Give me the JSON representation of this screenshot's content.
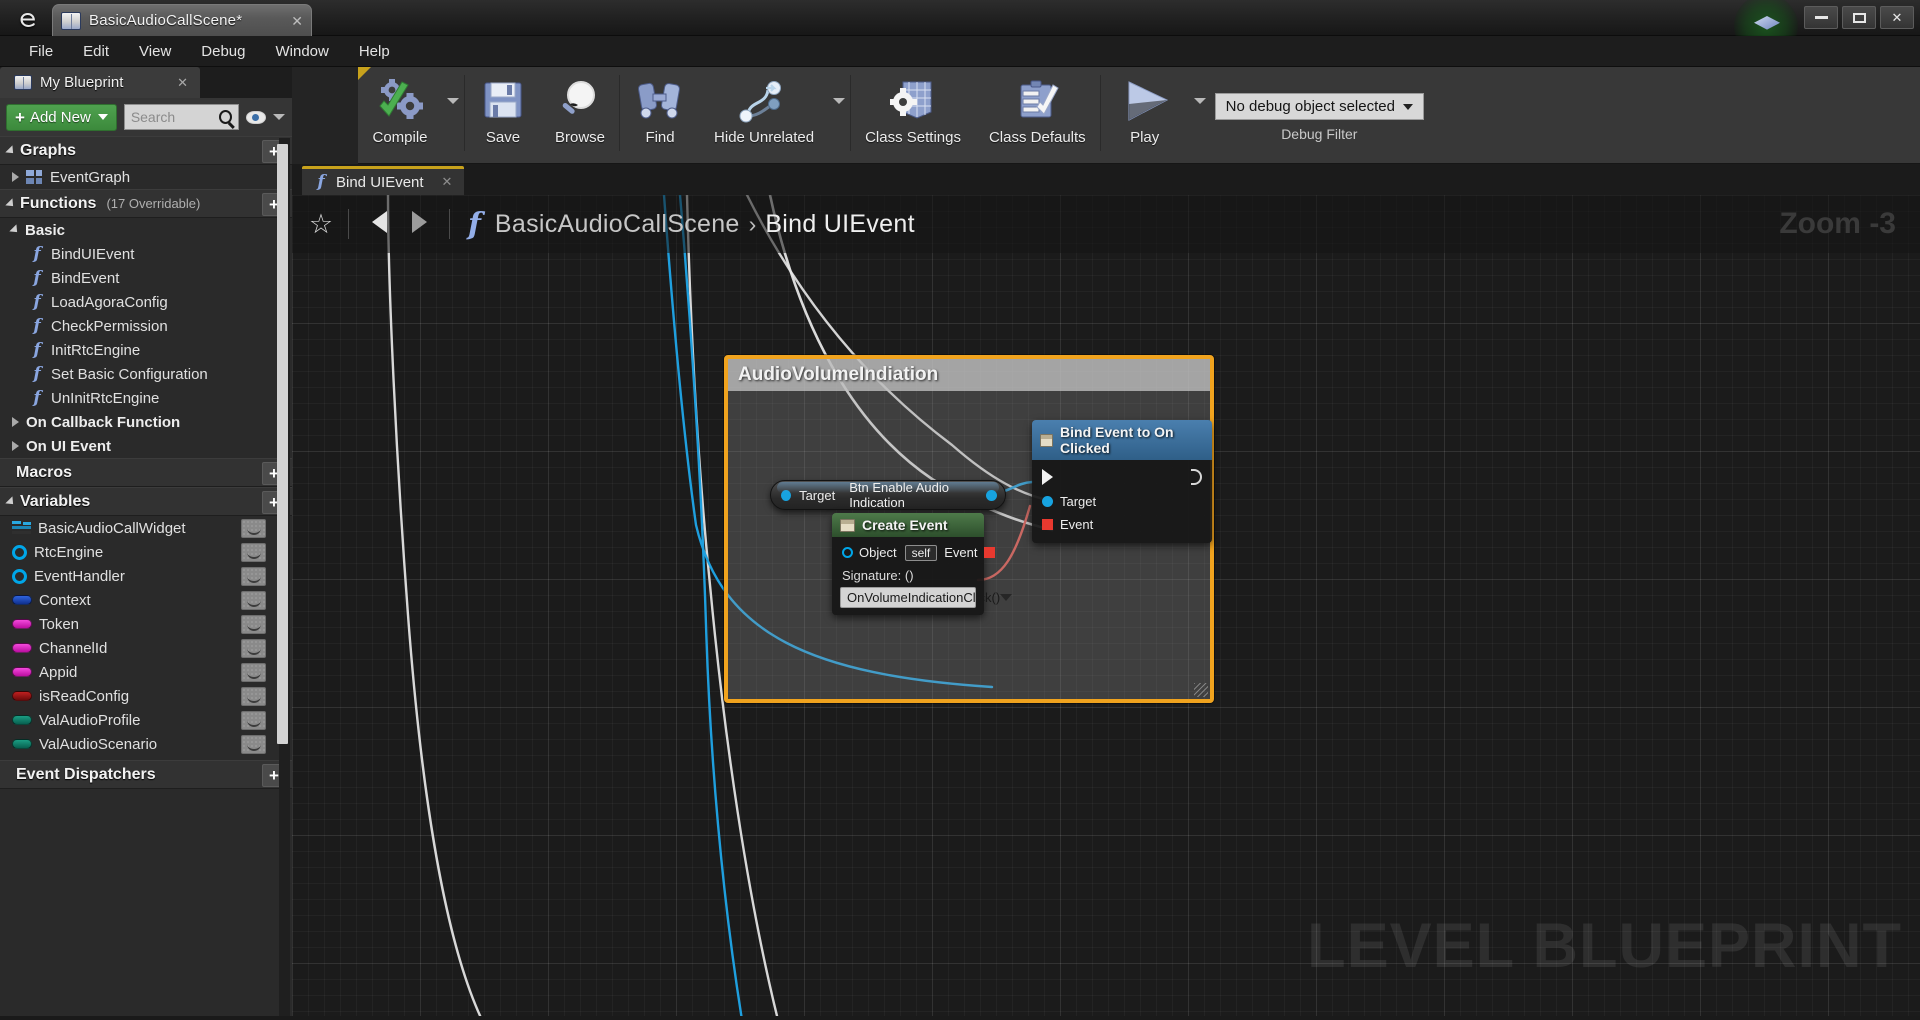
{
  "titlebar": {
    "logo": "unreal-logo",
    "tab_title": "BasicAudioCallScene*",
    "tab_icon": "blueprint-book-icon",
    "close_label": "✕",
    "orb_icon": "tutorial-hat-icon",
    "minimize_label": "minimize",
    "maximize_label": "maximize",
    "close_window_label": "✕"
  },
  "menubar": {
    "items": [
      "File",
      "Edit",
      "View",
      "Debug",
      "Window",
      "Help"
    ]
  },
  "toolbar": {
    "buttons": [
      {
        "label": "Compile",
        "icon": "compile-gears-check-icon",
        "has_dropdown": true
      },
      {
        "label": "Save",
        "icon": "save-floppy-icon",
        "has_dropdown": false
      },
      {
        "label": "Browse",
        "icon": "browse-magnifier-icon",
        "has_dropdown": false
      },
      {
        "label": "Find",
        "icon": "find-binoculars-icon",
        "has_dropdown": false
      },
      {
        "label": "Hide Unrelated",
        "icon": "hide-unrelated-nodes-icon",
        "has_dropdown": true
      },
      {
        "label": "Class Settings",
        "icon": "class-settings-gear-icon",
        "has_dropdown": false
      },
      {
        "label": "Class Defaults",
        "icon": "class-defaults-clipboard-icon",
        "has_dropdown": false
      },
      {
        "label": "Play",
        "icon": "play-triangle-icon",
        "has_dropdown": true
      }
    ],
    "debug_filter": {
      "value": "No debug object selected",
      "caption": "Debug Filter"
    }
  },
  "sidebar": {
    "tab": {
      "label": "My Blueprint",
      "icon": "blueprint-book-icon",
      "close": "✕"
    },
    "add_new_label": "Add New",
    "search": {
      "placeholder": "Search",
      "value": ""
    },
    "eye_icon": "visibility-eye-icon",
    "sections": [
      {
        "title": "Graphs",
        "expanded": true,
        "add_label": "+",
        "items": [
          {
            "label": "EventGraph",
            "icon": "event-graph-icon",
            "indent": 1,
            "expandable": true
          }
        ]
      },
      {
        "title": "Functions",
        "subtitle": "(17 Overridable)",
        "expanded": true,
        "add_label": "+",
        "groups": [
          {
            "label": "Basic",
            "expanded": true,
            "items": [
              {
                "label": "BindUIEvent",
                "icon": "function-icon"
              },
              {
                "label": "BindEvent",
                "icon": "function-icon"
              },
              {
                "label": "LoadAgoraConfig",
                "icon": "function-icon"
              },
              {
                "label": "CheckPermission",
                "icon": "function-icon"
              },
              {
                "label": "InitRtcEngine",
                "icon": "function-icon"
              },
              {
                "label": "Set Basic Configuration",
                "icon": "function-icon"
              },
              {
                "label": "UnInitRtcEngine",
                "icon": "function-icon"
              }
            ]
          },
          {
            "label": "On Callback Function",
            "expanded": false,
            "items": []
          },
          {
            "label": "On UI Event",
            "expanded": false,
            "items": []
          }
        ]
      },
      {
        "title": "Macros",
        "expanded": false,
        "add_label": "+",
        "items": []
      },
      {
        "title": "Variables",
        "expanded": true,
        "add_label": "+",
        "items": [
          {
            "label": "BasicAudioCallWidget",
            "icon": "widget-variable-icon",
            "color": "#29a8e0"
          },
          {
            "label": "RtcEngine",
            "icon": "object-ref-variable-icon",
            "color": "#00a6e8"
          },
          {
            "label": "EventHandler",
            "icon": "object-ref-variable-icon",
            "color": "#00a6e8"
          },
          {
            "label": "Context",
            "icon": "struct-variable-icon",
            "color": "#1b49c9"
          },
          {
            "label": "Token",
            "icon": "string-variable-icon",
            "color": "#e318c8"
          },
          {
            "label": "ChannelId",
            "icon": "string-variable-icon",
            "color": "#e318c8"
          },
          {
            "label": "Appid",
            "icon": "string-variable-icon",
            "color": "#e318c8"
          },
          {
            "label": "isReadConfig",
            "icon": "bool-variable-icon",
            "color": "#9c1414"
          },
          {
            "label": "ValAudioProfile",
            "icon": "enum-variable-icon",
            "color": "#0f7a66"
          },
          {
            "label": "ValAudioScenario",
            "icon": "enum-variable-icon",
            "color": "#0f7a66"
          }
        ]
      },
      {
        "title": "Event Dispatchers",
        "expanded": false,
        "add_label": "+",
        "items": []
      }
    ]
  },
  "graph": {
    "tab": {
      "label": "Bind UIEvent",
      "icon": "function-icon",
      "close": "✕"
    },
    "breadcrumb": {
      "star_icon": "favorite-star-icon",
      "back_icon": "nav-back-arrow-icon",
      "forward_icon": "nav-forward-arrow-icon",
      "fx_icon": "function-icon",
      "root": "BasicAudioCallScene",
      "separator": "›",
      "current": "Bind UIEvent"
    },
    "zoom_indicator": "Zoom -3",
    "watermark": "LEVEL BLUEPRINT",
    "comment": {
      "title": "AudioVolumeIndiation",
      "border_color": "#f0a31e"
    },
    "nodes": [
      {
        "id": "bind-event-to-on-clicked",
        "title": "Bind Event to On Clicked",
        "header_color": "#3a6d9c",
        "icon": "node-function-icon",
        "pins": [
          {
            "type": "exec-in",
            "label": ""
          },
          {
            "type": "exec-out",
            "label": ""
          },
          {
            "type": "data-in",
            "label": "Target",
            "color": "#17a3e0"
          },
          {
            "type": "data-in",
            "label": "Event",
            "color": "#e8392f"
          }
        ]
      },
      {
        "id": "btn-enable-audio-indication",
        "title": "Btn Enable Audio Indication",
        "kind": "pure-variable-get",
        "input_label": "Target"
      },
      {
        "id": "create-event",
        "title": "Create Event",
        "header_color": "#3f6a3c",
        "icon": "node-function-icon",
        "object_label": "Object",
        "object_value": "self",
        "event_label": "Event",
        "signature_label": "Signature: ()",
        "signature_value": "OnVolumeIndicationClick()"
      }
    ]
  }
}
